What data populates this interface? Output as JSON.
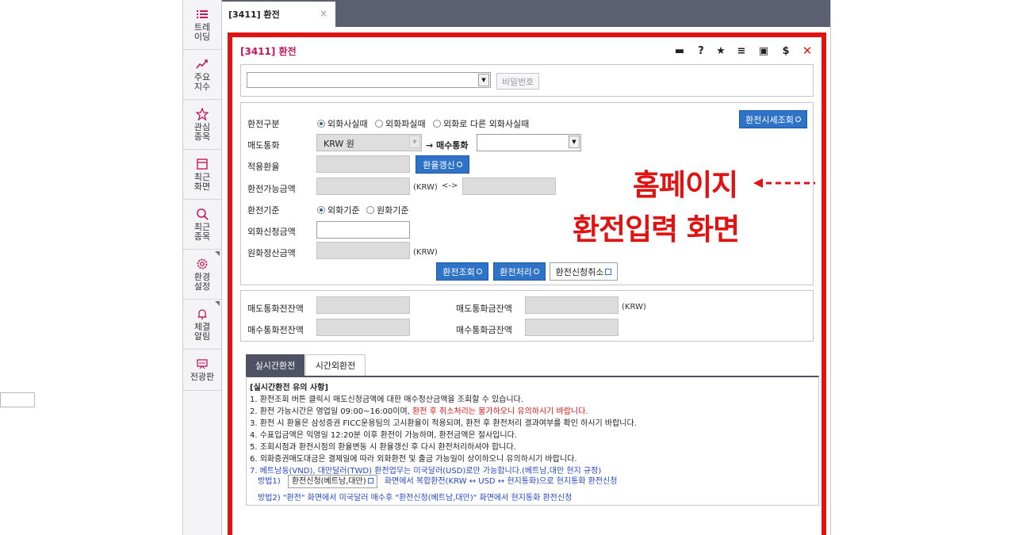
{
  "sidebar": {
    "items": [
      {
        "label": "트레이딩",
        "icon": "list-icon"
      },
      {
        "label": "주요지수",
        "icon": "chart-line-icon"
      },
      {
        "label": "관심종목",
        "icon": "star-icon"
      },
      {
        "label": "최근화면",
        "icon": "window-icon"
      },
      {
        "label": "최근종목",
        "icon": "search-icon"
      },
      {
        "label": "환경설정",
        "icon": "gear-icon"
      },
      {
        "label": "체결알림",
        "icon": "bell-icon"
      },
      {
        "label": "전광판",
        "icon": "board-icon"
      }
    ]
  },
  "tab": {
    "label": "[3411] 환전",
    "close": "×"
  },
  "window": {
    "title": "[3411] 환전",
    "toolbar": {
      "chat": "▬",
      "help": "?",
      "star": "★",
      "tree": "≡",
      "save": "▣",
      "dollar": "$",
      "close": "✕"
    }
  },
  "account": {
    "password_label": "비밀번호"
  },
  "form": {
    "exchange_type_label": "환전구분",
    "exchange_type_options": [
      "외화사실때",
      "외화파실때",
      "외화로 다른 외화사실때"
    ],
    "rate_inquiry_button": "환전시세조회",
    "sell_currency_label": "매도통화",
    "sell_currency_value": "KRW 원",
    "arrow_buy_label": "→ 매수통화",
    "applied_rate_label": "적용환율",
    "refresh_rate_button": "환율갱신",
    "available_amount_label": "환전가능금액",
    "available_unit": "(KRW)",
    "swap_symbol": "<->",
    "basis_label": "환전기준",
    "basis_options": [
      "외화기준",
      "원화기준"
    ],
    "fx_apply_label": "외화신청금액",
    "krw_settle_label": "원화정산금액",
    "krw_settle_unit": "(KRW)",
    "inquiry_button": "환전조회",
    "process_button": "환전처리",
    "cancel_button": "환전신청취소"
  },
  "balance": {
    "sell_pre_label": "매도통화전잔액",
    "sell_amt_label": "매도통화금잔액",
    "sell_unit": "(KRW)",
    "buy_pre_label": "매수통화전잔액",
    "buy_amt_label": "매수통화금잔액"
  },
  "tabs": [
    "실시간환전",
    "시간외환전"
  ],
  "notice": {
    "title": "[실시간환전 유의 사항]",
    "line1": "1. 환전조회 버튼 클릭시 매도신청금액에 대한 매수정산금액을 조회할 수 있습니다.",
    "line2a": "2. 환전 가능시간은 영업일 09:00~16:00이며, ",
    "line2b": "환전 후 취소처리는 불가하오니 유의하시기 바랍니다.",
    "line3": "3. 환전 시 환율은 삼성증권 FICC운용팀의 고시환율이 적용되며, 환전 후 환전처리 결과여부를 확인 하시기 바랍니다.",
    "line4": "4. 수표입금액은 익영일 12:20분 이후 환전이 가능하며, 환전금액은 절사입니다.",
    "line5": "5. 조회시점과 환전시점의 환율변동 시 환율갱신 후 다시 환전처리하셔야 합니다.",
    "line6": "6. 외화증권매도대금은 결제일에 따라 외화환전 및 출금 가능일이 상이하오니 유의하시기 바랍니다.",
    "line7": "7. 베트남동(VND), 대만달러(TWD) 환전업무는 미국달러(USD)로만 가능합니다.(베트남,대만 현지 규정)",
    "method1_prefix": "방법1)",
    "method1_button": "환전신청(베트남,대만)",
    "method1_suffix": "화면에서 복합환전(KRW ↔ USD ↔ 현지통화)으로 현지통화 환전신청",
    "method2": "방법2) \"환전\" 화면에서 미국달러 매수후 \"환전신청(베트남,대만)\" 화면에서 현지통화 환전신청"
  },
  "annotation": {
    "line1": "홈페이지",
    "line2": "환전입력 화면"
  },
  "colors": {
    "highlight": "#e01313",
    "title": "#c2185b",
    "button": "#2f73c8",
    "tabbar": "#5c5f70"
  }
}
